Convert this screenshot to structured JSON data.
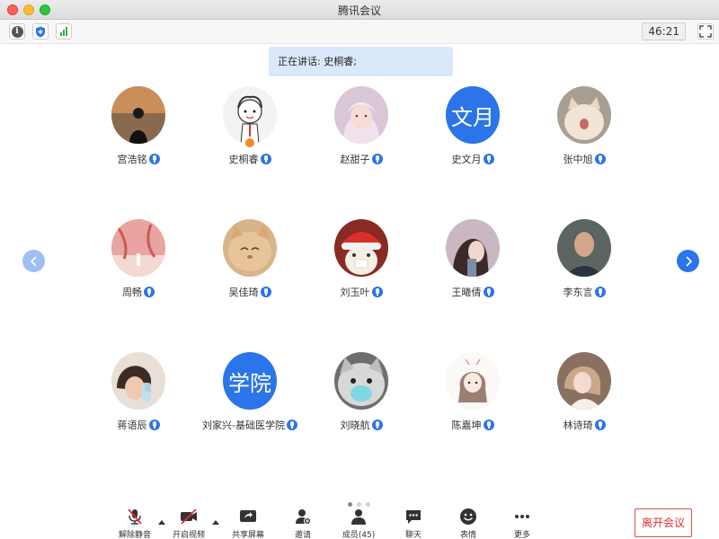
{
  "window": {
    "title": "腾讯会议"
  },
  "toolbar": {
    "timer": "46:21"
  },
  "banner": {
    "text": "正在讲话: 史桐睿;"
  },
  "participants": [
    {
      "name": "宫浩铭",
      "avatar": "photo"
    },
    {
      "name": "史桐睿",
      "avatar": "cartoon",
      "host": true
    },
    {
      "name": "赵甜子",
      "avatar": "photo"
    },
    {
      "name": "史文月",
      "avatar_text": "文月"
    },
    {
      "name": "张中旭",
      "avatar": "photo"
    },
    {
      "name": "周畅",
      "avatar": "photo"
    },
    {
      "name": "吴佳琦",
      "avatar": "photo"
    },
    {
      "name": "刘玉叶",
      "avatar": "photo"
    },
    {
      "name": "王曦倩",
      "avatar": "photo"
    },
    {
      "name": "李东言",
      "avatar": "photo"
    },
    {
      "name": "蒋语辰",
      "avatar": "photo"
    },
    {
      "name": "刘家兴-基础医学院",
      "avatar_text": "学院"
    },
    {
      "name": "刘晓航",
      "avatar": "photo"
    },
    {
      "name": "陈嘉坤",
      "avatar": "drawing"
    },
    {
      "name": "林诗琦",
      "avatar": "photo"
    }
  ],
  "controls": [
    {
      "label": "解除静音",
      "icon": "mic-muted-icon"
    },
    {
      "label": "开启视频",
      "icon": "video-off-icon"
    },
    {
      "label": "共享屏幕",
      "icon": "share-screen-icon"
    },
    {
      "label": "邀请",
      "icon": "invite-icon"
    },
    {
      "label": "成员(45)",
      "icon": "members-icon"
    },
    {
      "label": "聊天",
      "icon": "chat-icon"
    },
    {
      "label": "表情",
      "icon": "emoji-icon"
    },
    {
      "label": "更多",
      "icon": "more-icon"
    }
  ],
  "leave_label": "离开会议",
  "colors": {
    "accent": "#2b74ea",
    "banner": "#dbe8fb",
    "leave": "#e03030"
  }
}
